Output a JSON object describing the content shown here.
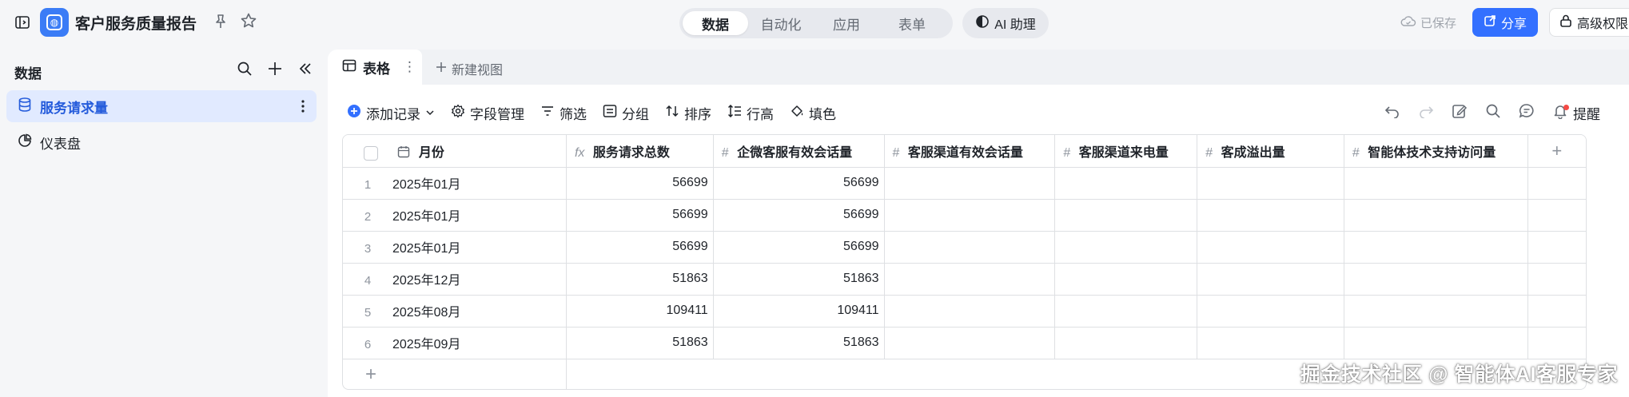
{
  "header": {
    "doc_title": "客户服务质量报告",
    "mode_tabs": [
      {
        "label": "数据",
        "active": true
      },
      {
        "label": "自动化",
        "active": false
      },
      {
        "label": "应用",
        "active": false
      },
      {
        "label": "表单",
        "active": false
      }
    ],
    "ai_assistant": "AI 助理",
    "saved_status": "已保存",
    "share_label": "分享",
    "permissions_label": "高级权限"
  },
  "sidebar": {
    "heading": "数据",
    "items": [
      {
        "label": "服务请求量",
        "active": true,
        "icon": "database-icon"
      },
      {
        "label": "仪表盘",
        "active": false,
        "icon": "dashboard-icon"
      }
    ]
  },
  "views": {
    "active_tab": "表格",
    "new_view": "新建视图"
  },
  "toolbar": {
    "add_record": "添加记录",
    "field_manage": "字段管理",
    "filter": "筛选",
    "group": "分组",
    "sort": "排序",
    "row_height": "行高",
    "fill_color": "填色",
    "remind": "提醒"
  },
  "table": {
    "columns": [
      "月份",
      "服务请求总数",
      "企微客服有效会话量",
      "客服渠道有效会话量",
      "客服渠道来电量",
      "客成溢出量",
      "智能体技术支持访问量"
    ],
    "rows": [
      {
        "index": "1",
        "month": "2025年01月",
        "total": "56699",
        "wecom": "56699"
      },
      {
        "index": "2",
        "month": "2025年01月",
        "total": "56699",
        "wecom": "56699"
      },
      {
        "index": "3",
        "month": "2025年01月",
        "total": "56699",
        "wecom": "56699"
      },
      {
        "index": "4",
        "month": "2025年12月",
        "total": "51863",
        "wecom": "51863"
      },
      {
        "index": "5",
        "month": "2025年08月",
        "total": "109411",
        "wecom": "109411"
      },
      {
        "index": "6",
        "month": "2025年09月",
        "total": "51863",
        "wecom": "51863"
      }
    ]
  },
  "watermark": "掘金技术社区 @ 智能体AI客服专家",
  "colors": {
    "accent": "#3370ff",
    "logo": "#3b7cf6",
    "active_bg": "#e1eaff",
    "active_text": "#245bdb",
    "badge": "#f54a45"
  }
}
